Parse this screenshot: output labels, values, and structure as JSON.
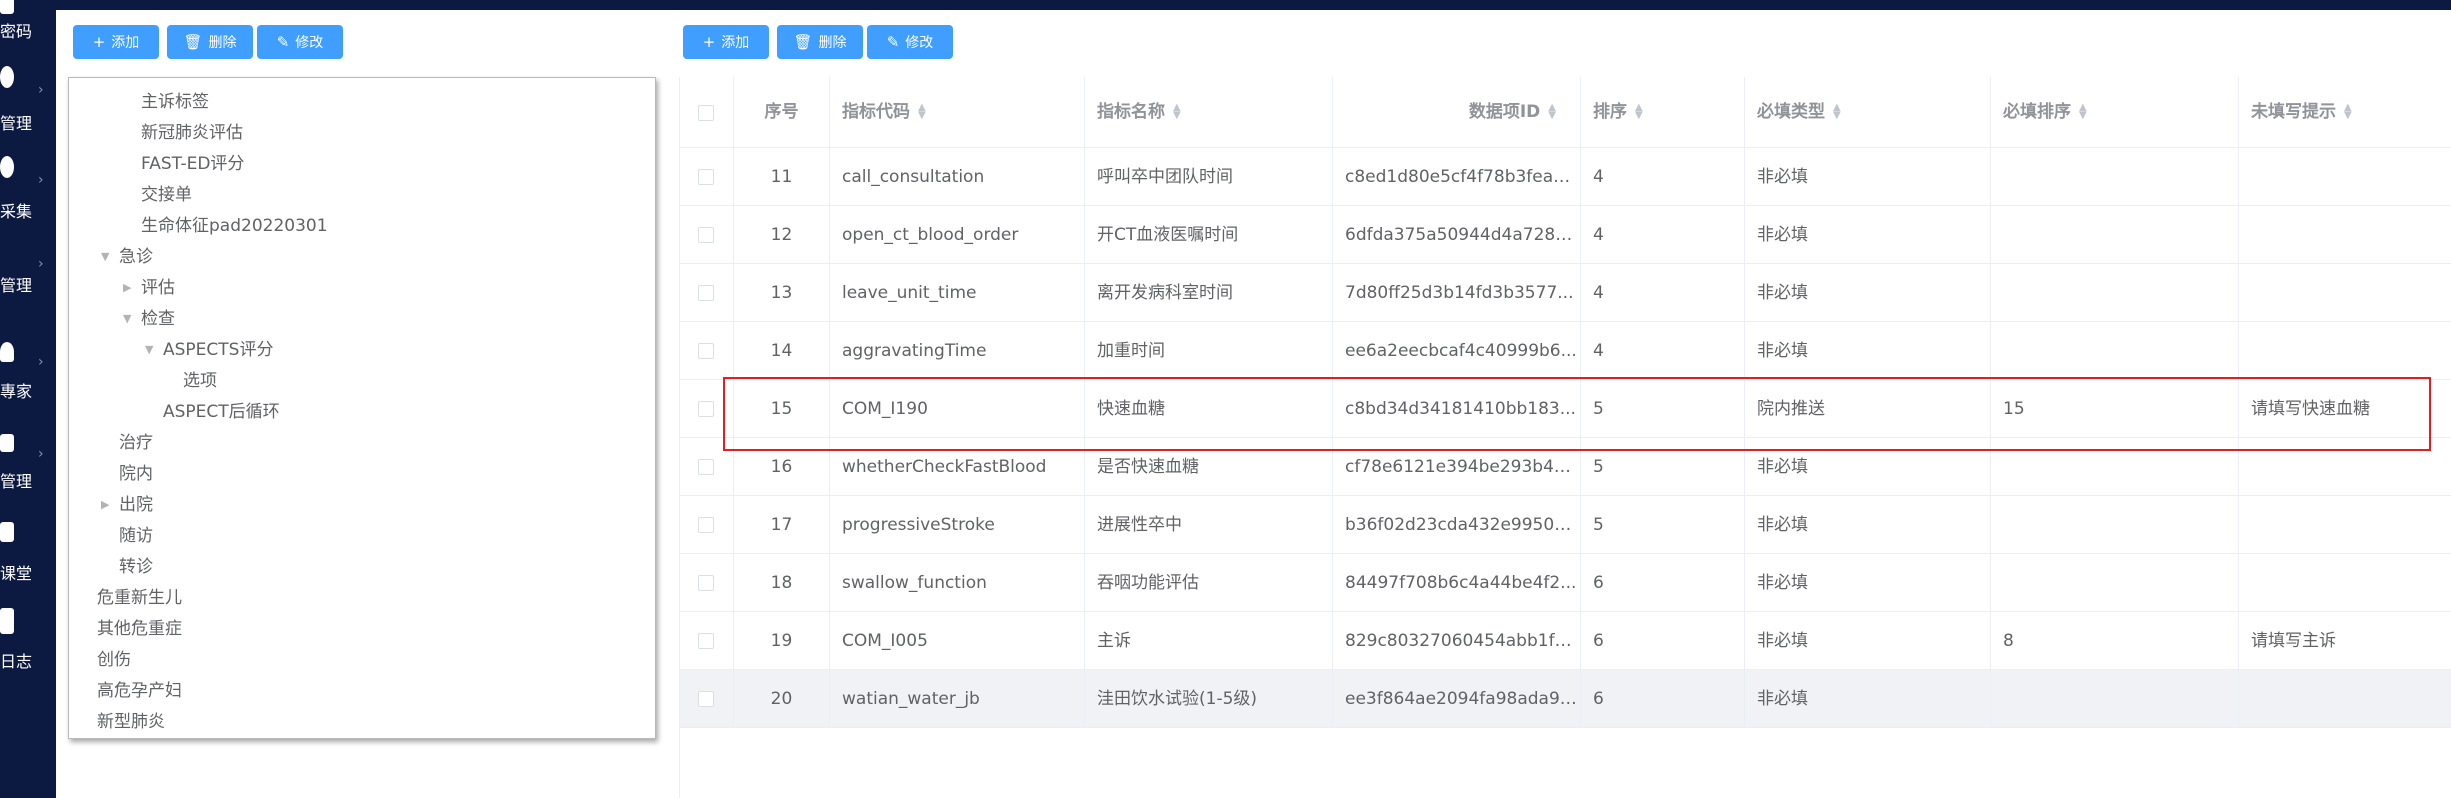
{
  "sidebar": {
    "items": [
      {
        "label": "密码",
        "icon": "key-icon"
      },
      {
        "label": "管理",
        "icon": "gear-icon"
      },
      {
        "label": "采集",
        "icon": "collect-icon"
      },
      {
        "label": "管理",
        "icon": "manage-icon"
      },
      {
        "label": "專家",
        "icon": "user-icon"
      },
      {
        "label": "管理",
        "icon": "manage2-icon"
      },
      {
        "label": "课堂",
        "icon": "class-icon"
      },
      {
        "label": "日志",
        "icon": "log-icon"
      }
    ]
  },
  "left_toolbar": {
    "add": "添加",
    "delete": "删除",
    "edit": "修改"
  },
  "right_toolbar": {
    "add": "添加",
    "delete": "删除",
    "edit": "修改"
  },
  "tree": {
    "nodes": [
      {
        "label": "主诉标签"
      },
      {
        "label": "新冠肺炎评估"
      },
      {
        "label": "FAST-ED评分"
      },
      {
        "label": "交接单"
      },
      {
        "label": "生命体征pad20220301"
      },
      {
        "label": "急诊"
      },
      {
        "label": "评估"
      },
      {
        "label": "检查"
      },
      {
        "label": "ASPECTS评分"
      },
      {
        "label": "选项"
      },
      {
        "label": "ASPECT后循环"
      },
      {
        "label": "治疗"
      },
      {
        "label": "院内"
      },
      {
        "label": "出院"
      },
      {
        "label": "随访"
      },
      {
        "label": "转诊"
      },
      {
        "label": "危重新生儿"
      },
      {
        "label": "其他危重症"
      },
      {
        "label": "创伤"
      },
      {
        "label": "高危孕产妇"
      },
      {
        "label": "新型肺炎"
      }
    ]
  },
  "table": {
    "headers": {
      "index": "序号",
      "code": "指标代码",
      "name": "指标名称",
      "data_id": "数据项ID",
      "order": "排序",
      "req_type": "必填类型",
      "req_order": "必填排序",
      "hint": "未填写提示"
    },
    "rows": [
      {
        "index": "11",
        "code": "call_consultation",
        "name": "呼叫卒中团队时间",
        "data_id": "c8ed1d80e5cf4f78b3fea3...",
        "order": "4",
        "req_type": "非必填",
        "req_order": "",
        "hint": ""
      },
      {
        "index": "12",
        "code": "open_ct_blood_order",
        "name": "开CT血液医嘱时间",
        "data_id": "6dfda375a50944d4a728e...",
        "order": "4",
        "req_type": "非必填",
        "req_order": "",
        "hint": ""
      },
      {
        "index": "13",
        "code": "leave_unit_time",
        "name": "离开发病科室时间",
        "data_id": "7d80ff25d3b14fd3b3577...",
        "order": "4",
        "req_type": "非必填",
        "req_order": "",
        "hint": ""
      },
      {
        "index": "14",
        "code": "aggravatingTime",
        "name": "加重时间",
        "data_id": "ee6a2eecbcaf4c40999b6...",
        "order": "4",
        "req_type": "非必填",
        "req_order": "",
        "hint": ""
      },
      {
        "index": "15",
        "code": "COM_I190",
        "name": "快速血糖",
        "data_id": "c8bd34d34181410bb183...",
        "order": "5",
        "req_type": "院内推送",
        "req_order": "15",
        "hint": "请填写快速血糖"
      },
      {
        "index": "16",
        "code": "whetherCheckFastBlood",
        "name": "是否快速血糖",
        "data_id": "cf78e6121e394be293b4e...",
        "order": "5",
        "req_type": "非必填",
        "req_order": "",
        "hint": ""
      },
      {
        "index": "17",
        "code": "progressiveStroke",
        "name": "进展性卒中",
        "data_id": "b36f02d23cda432e99508...",
        "order": "5",
        "req_type": "非必填",
        "req_order": "",
        "hint": ""
      },
      {
        "index": "18",
        "code": "swallow_function",
        "name": "吞咽功能评估",
        "data_id": "84497f708b6c4a44be4f2...",
        "order": "6",
        "req_type": "非必填",
        "req_order": "",
        "hint": ""
      },
      {
        "index": "19",
        "code": "COM_I005",
        "name": "主诉",
        "data_id": "829c80327060454abb1fc...",
        "order": "6",
        "req_type": "非必填",
        "req_order": "8",
        "hint": "请填写主诉"
      },
      {
        "index": "20",
        "code": "watian_water_jb",
        "name": "洼田饮水试验(1-5级)",
        "data_id": "ee3f864ae2094fa98ada95...",
        "order": "6",
        "req_type": "非必填",
        "req_order": "",
        "hint": ""
      }
    ]
  },
  "colors": {
    "primary": "#409eff",
    "sidebar": "#0c1941",
    "highlight_border": "#e02020",
    "hover_row": "#f0f2f5"
  }
}
